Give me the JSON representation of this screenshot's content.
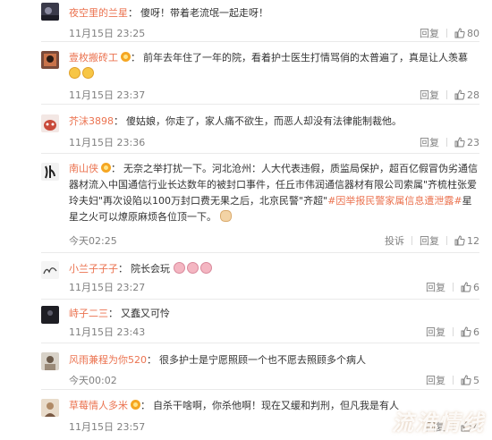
{
  "comments": [
    {
      "nickname": "夜空里的兰星",
      "text": "傻呀！带着老流氓一起走呀！",
      "time": "11月15日 23:25",
      "reply": "回复",
      "likes": "80"
    },
    {
      "nickname": "壹枚搬砖工",
      "text": "前年去年住了一年的院，看着护士医生打情骂俏的太普遍了，真是让人羡慕",
      "time": "11月15日 23:37",
      "reply": "回复",
      "likes": "28"
    },
    {
      "nickname": "芥沫3898",
      "text": "傻姑娘，你走了，家人痛不欲生，而恶人却没有法律能制裁他。",
      "time": "11月15日 23:36",
      "reply": "回复",
      "likes": "23"
    },
    {
      "nickname": "南山侠",
      "text_before": "无奈之举打扰一下。河北沧州：人大代表违假，质监局保护，超百亿假冒伪劣通信器材流入中国通信行业长达数年的被封口事件，任丘市伟润通信器材有限公司索属\"齐梳柱张爱玲夫妇\"再次设陷以100万封口费无果之后，北京民警\"齐超\"",
      "hashtag": "#因举报民警家属信息遭泄露#",
      "text_after": "星星之火可以燎原麻烦各位顶一下。",
      "time": "今天02:25",
      "report": "投诉",
      "reply": "回复",
      "likes": "12"
    },
    {
      "nickname": "小兰子子子",
      "text": "院长会玩",
      "time": "11月15日 23:27",
      "reply": "回复",
      "likes": "6"
    },
    {
      "nickname": "峙子二三",
      "text": "又蠢又可怜",
      "time": "11月15日 23:43",
      "reply": "回复",
      "likes": "6"
    },
    {
      "nickname": "风雨兼程为你520",
      "text": "很多护士是宁愿照顾一个也不愿去照顾多个病人",
      "time": "今天00:02",
      "reply": "回复",
      "likes": "5"
    },
    {
      "nickname": "草莓情人多米",
      "text": "自杀干啥啊，你杀他啊！现在又缓和判刑，但凡我是有人",
      "time": "11月15日 23:57",
      "reply": "回复",
      "likes": "4"
    }
  ],
  "watermark": "流淮情线",
  "colors": {
    "nickname": "#eb7350",
    "meta": "#808080",
    "divider": "#eaeaea"
  }
}
